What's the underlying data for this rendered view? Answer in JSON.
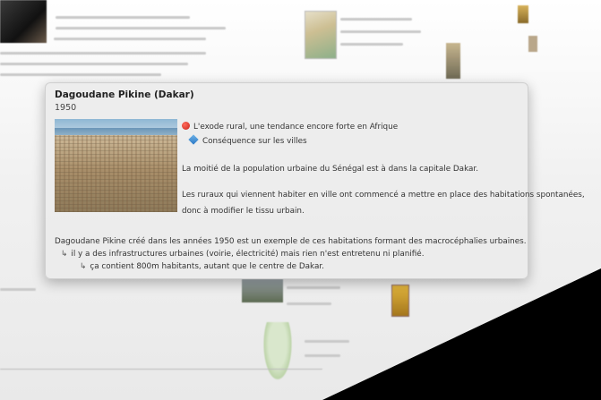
{
  "card": {
    "title": "Dagoudane Pikine (Dakar)",
    "date": "1950",
    "image_alt": "aerial photo of Dagoudane Pikine",
    "links": [
      {
        "icon": "red-dot-icon",
        "text": "L'exode rural, une tendance encore forte en Afrique"
      },
      {
        "icon": "blue-diamond-icon",
        "text": "Conséquence sur les villes"
      }
    ],
    "paragraphs": [
      "La moitié de la population urbaine du Sénégal est à dans la capitale Dakar.",
      "Les ruraux qui viennent habiter en ville ont commencé a mettre en place des habitations spontanées,",
      "donc à modifier le tissu urbain.",
      "Dagoudane Pikine créé dans les années 1950 est un exemple de ces habitations formant des macrocéphalies urbaines."
    ],
    "bullets": [
      {
        "arrow": "↳",
        "text": "il y a des infrastructures urbaines (voirie, électricité) mais rien n'est entretenu ni planifié."
      },
      {
        "arrow": "↳",
        "text": "ça contient 800m habitants, autant que le centre de Dakar."
      }
    ]
  },
  "colors": {
    "card_bg": "#ececec",
    "accent_red": "#c8231b",
    "accent_blue": "#2a78c5"
  }
}
